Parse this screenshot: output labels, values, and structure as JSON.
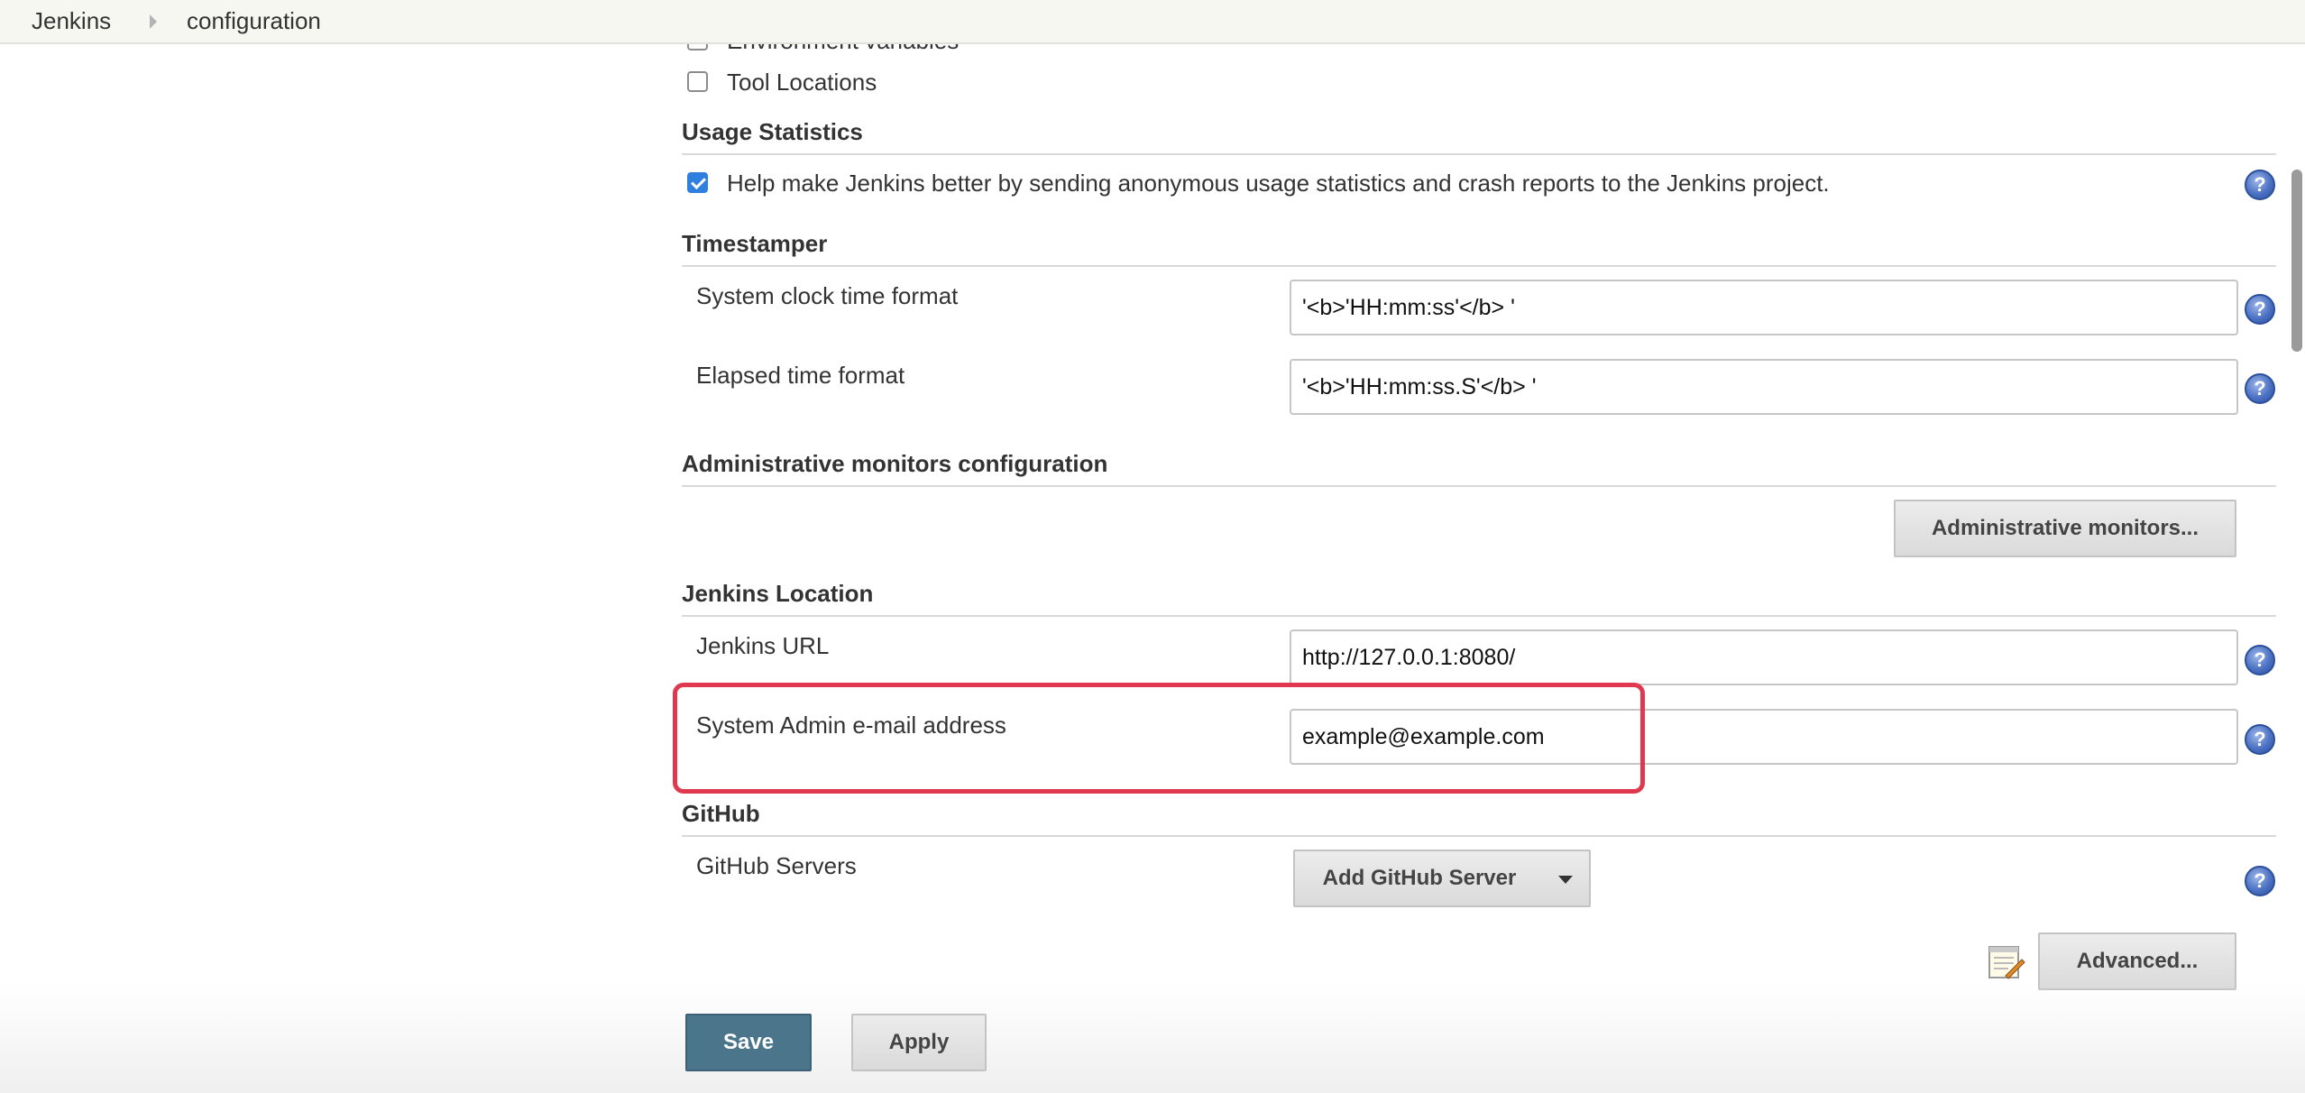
{
  "breadcrumb": {
    "root": "Jenkins",
    "current": "configuration"
  },
  "partial_row": {
    "label": "Environment variables"
  },
  "tool_locations": {
    "label": "Tool Locations",
    "checked": false
  },
  "usage_statistics": {
    "title": "Usage Statistics",
    "checkbox_label": "Help make Jenkins better by sending anonymous usage statistics and crash reports to the Jenkins project.",
    "checked": true
  },
  "timestamper": {
    "title": "Timestamper",
    "system_clock_label": "System clock time format",
    "system_clock_value": "'<b>'HH:mm:ss'</b> '",
    "elapsed_label": "Elapsed time format",
    "elapsed_value": "'<b>'HH:mm:ss.S'</b> '"
  },
  "admin_monitors": {
    "title": "Administrative monitors configuration",
    "button_label": "Administrative monitors..."
  },
  "jenkins_location": {
    "title": "Jenkins Location",
    "url_label": "Jenkins URL",
    "url_value": "http://127.0.0.1:8080/",
    "email_label": "System Admin e-mail address",
    "email_value": "example@example.com"
  },
  "github": {
    "title": "GitHub",
    "servers_label": "GitHub Servers",
    "add_server_button": "Add GitHub Server",
    "advanced_button": "Advanced..."
  },
  "actions": {
    "save_label": "Save",
    "apply_label": "Apply"
  },
  "help_glyph": "?",
  "colors": {
    "highlight": "#e0384f",
    "save_button": "#4b758b",
    "checkbox_checked": "#2f7fe0"
  },
  "icons": {
    "help": "help-icon",
    "dropdown": "caret-down-icon",
    "notepad": "notepad-icon"
  }
}
